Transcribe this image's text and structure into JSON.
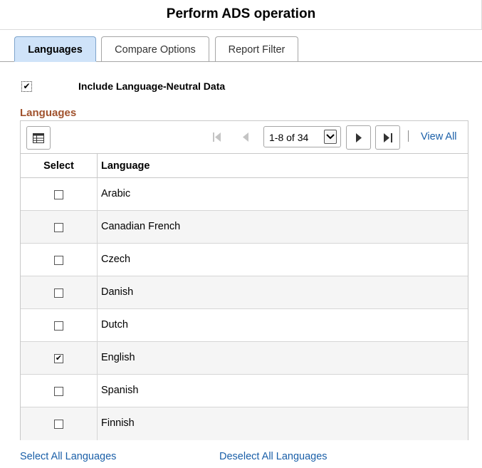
{
  "dialog": {
    "title": "Perform ADS operation"
  },
  "tabs": [
    {
      "label": "Languages",
      "active": true
    },
    {
      "label": "Compare Options",
      "active": false
    },
    {
      "label": "Report Filter",
      "active": false
    }
  ],
  "include_neutral": {
    "label": "Include Language-Neutral Data",
    "checked": true
  },
  "section": {
    "title": "Languages"
  },
  "toolbar": {
    "grid_icon": "grid-personalize-icon",
    "page_range": "1-8 of 34",
    "view_all_label": "View All"
  },
  "table": {
    "columns": [
      "Select",
      "Language"
    ],
    "rows": [
      {
        "language": "Arabic",
        "selected": false
      },
      {
        "language": "Canadian French",
        "selected": false
      },
      {
        "language": "Czech",
        "selected": false
      },
      {
        "language": "Danish",
        "selected": false
      },
      {
        "language": "Dutch",
        "selected": false
      },
      {
        "language": "English",
        "selected": true
      },
      {
        "language": "Spanish",
        "selected": false
      },
      {
        "language": "Finnish",
        "selected": false
      }
    ]
  },
  "footer": {
    "select_all_label": "Select All Languages",
    "deselect_all_label": "Deselect All Languages"
  },
  "colors": {
    "link": "#1a5fa8",
    "section_title": "#a0522d",
    "active_tab": "#cfe3f9"
  }
}
